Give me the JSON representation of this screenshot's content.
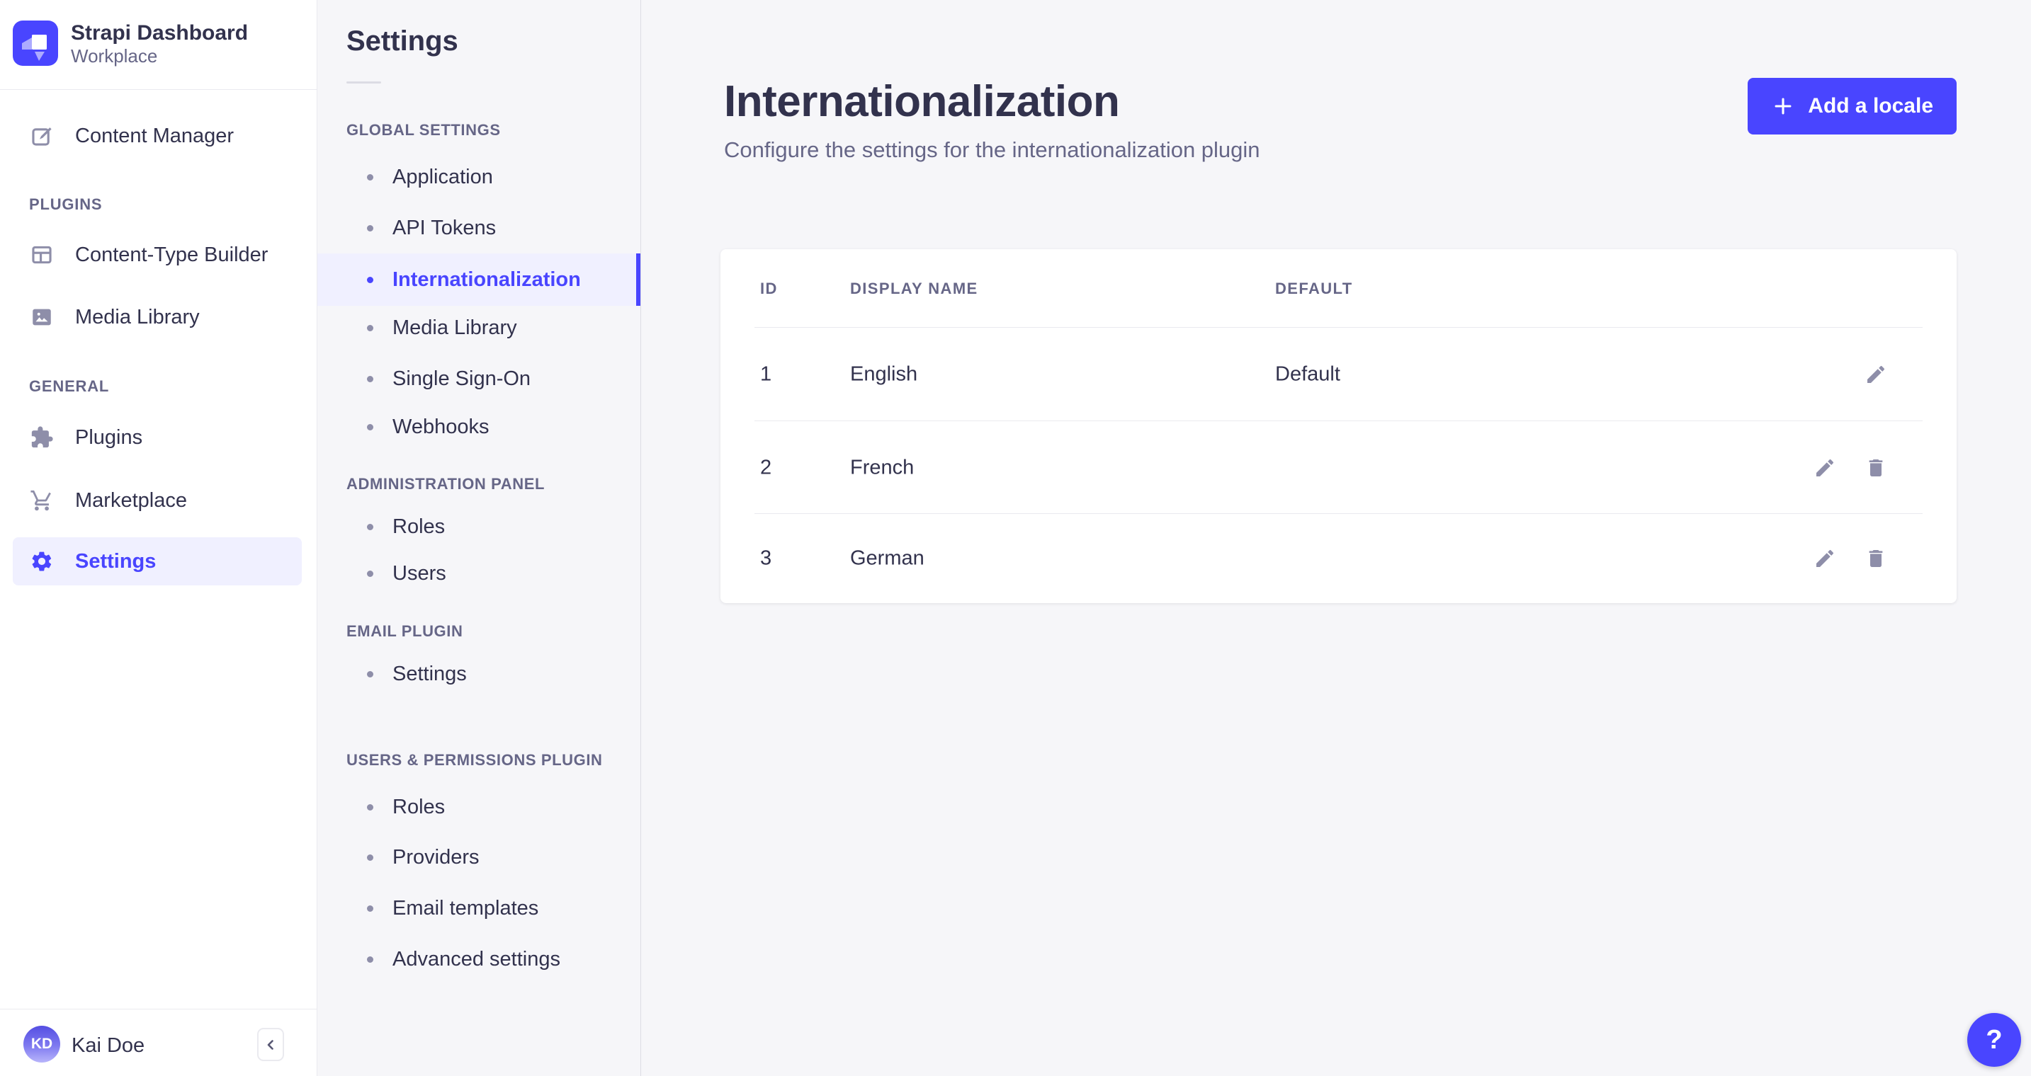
{
  "app": {
    "title": "Strapi Dashboard",
    "workspace": "Workplace",
    "user": {
      "name": "Kai Doe",
      "initials": "KD"
    },
    "help_label": "?"
  },
  "colors": {
    "primary": "#4945ff",
    "primary_light": "#f0f0ff",
    "text_dark": "#32324d",
    "text_muted": "#666687",
    "icon_gray": "#8e8ea9",
    "border": "#eaeaef",
    "background": "#f6f6f9"
  },
  "sidebar": {
    "sections": [
      {
        "label": "",
        "items": [
          {
            "label": "Content Manager",
            "icon": "pen-square-icon",
            "selected": false
          }
        ]
      },
      {
        "label": "PLUGINS",
        "items": [
          {
            "label": "Content-Type Builder",
            "icon": "layout-icon",
            "selected": false
          },
          {
            "label": "Media Library",
            "icon": "image-icon",
            "selected": false
          }
        ]
      },
      {
        "label": "GENERAL",
        "items": [
          {
            "label": "Plugins",
            "icon": "puzzle-icon",
            "selected": false
          },
          {
            "label": "Marketplace",
            "icon": "cart-icon",
            "selected": false
          },
          {
            "label": "Settings",
            "icon": "gear-icon",
            "selected": true
          }
        ]
      }
    ]
  },
  "settings_nav": {
    "title": "Settings",
    "groups": [
      {
        "label": "GLOBAL SETTINGS",
        "items": [
          "Application",
          "API Tokens",
          "Internationalization",
          "Media Library",
          "Single Sign-On",
          "Webhooks"
        ],
        "selected": "Internationalization"
      },
      {
        "label": "ADMINISTRATION PANEL",
        "items": [
          "Roles",
          "Users"
        ]
      },
      {
        "label": "EMAIL PLUGIN",
        "items": [
          "Settings"
        ]
      },
      {
        "label": "USERS & PERMISSIONS PLUGIN",
        "items": [
          "Roles",
          "Providers",
          "Email templates",
          "Advanced settings"
        ]
      }
    ]
  },
  "page": {
    "title": "Internationalization",
    "subtitle": "Configure the settings for the internationalization plugin",
    "add_button_label": "Add a locale"
  },
  "table": {
    "columns": [
      "ID",
      "DISPLAY NAME",
      "DEFAULT"
    ],
    "rows": [
      {
        "id": "1",
        "display_name": "English",
        "default": "Default",
        "actions": [
          "edit"
        ]
      },
      {
        "id": "2",
        "display_name": "French",
        "default": "",
        "actions": [
          "edit",
          "delete"
        ]
      },
      {
        "id": "3",
        "display_name": "German",
        "default": "",
        "actions": [
          "edit",
          "delete"
        ]
      }
    ]
  }
}
